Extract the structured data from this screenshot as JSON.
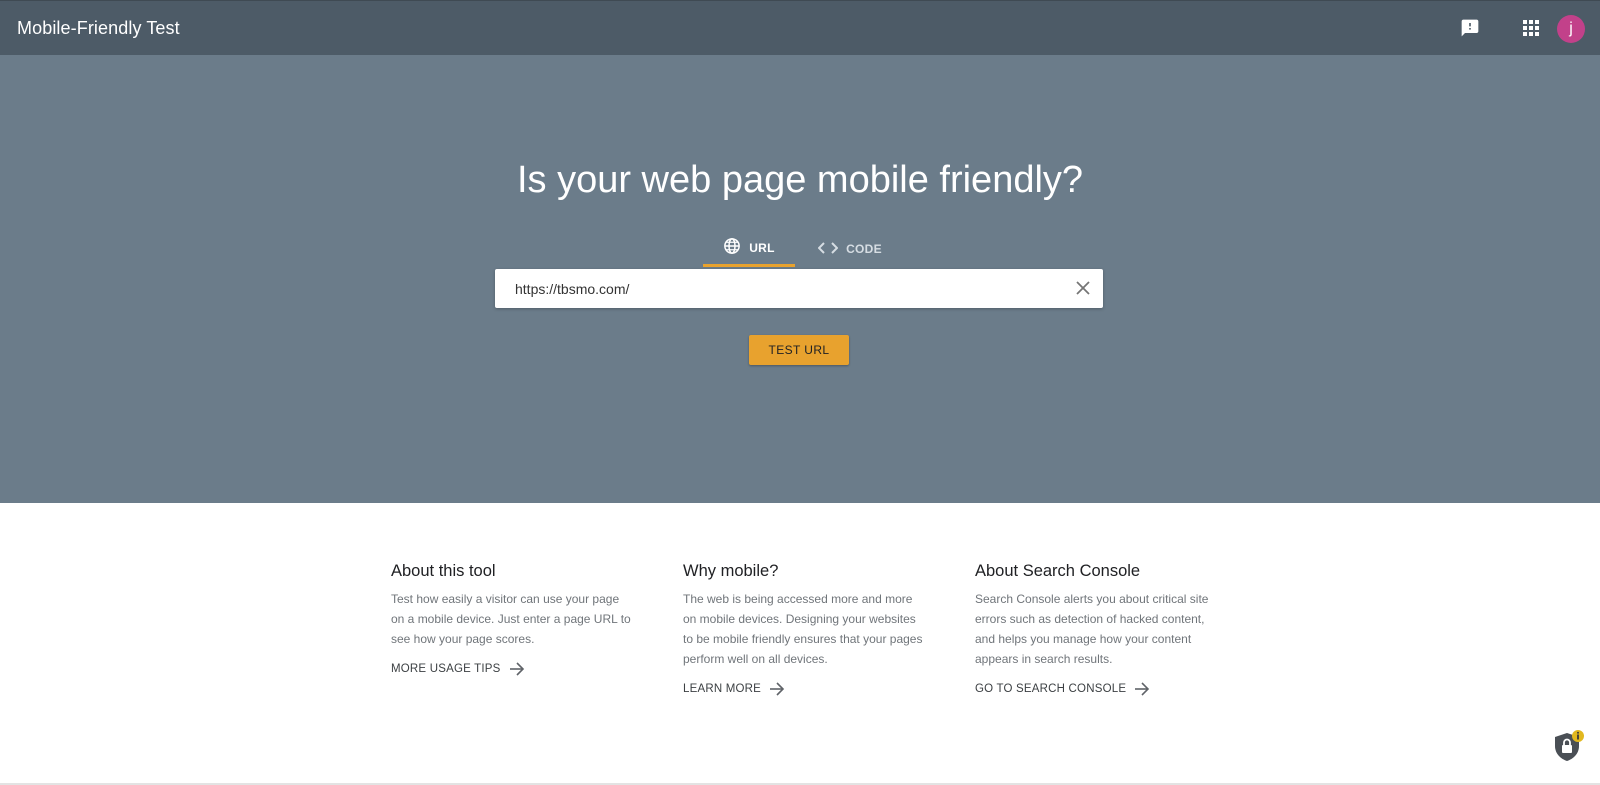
{
  "header": {
    "title": "Mobile-Friendly Test",
    "feedback_icon": "feedback-icon",
    "apps_icon": "apps-grid-icon",
    "avatar_letter": "j",
    "avatar_color": "#c2418a"
  },
  "hero": {
    "title": "Is your web page mobile friendly?",
    "tabs": [
      {
        "label": "URL",
        "icon": "globe-icon",
        "active": true
      },
      {
        "label": "CODE",
        "icon": "code-icon",
        "active": false
      }
    ],
    "url_input": {
      "value": "https://tbsmo.com/"
    },
    "test_button_label": "TEST URL",
    "accent_color": "#e8a22e"
  },
  "info": [
    {
      "heading": "About this tool",
      "body": "Test how easily a visitor can use your page on a mobile device. Just enter a page URL to see how your page scores.",
      "link": "MORE USAGE TIPS"
    },
    {
      "heading": "Why mobile?",
      "body": "The web is being accessed more and more on mobile devices. Designing your websites to be mobile friendly ensures that your pages perform well on all devices.",
      "link": "LEARN MORE"
    },
    {
      "heading": "About Search Console",
      "body": "Search Console alerts you about critical site errors such as detection of hacked content, and helps you manage how your content appears in search results.",
      "link": "GO TO SEARCH CONSOLE"
    }
  ]
}
